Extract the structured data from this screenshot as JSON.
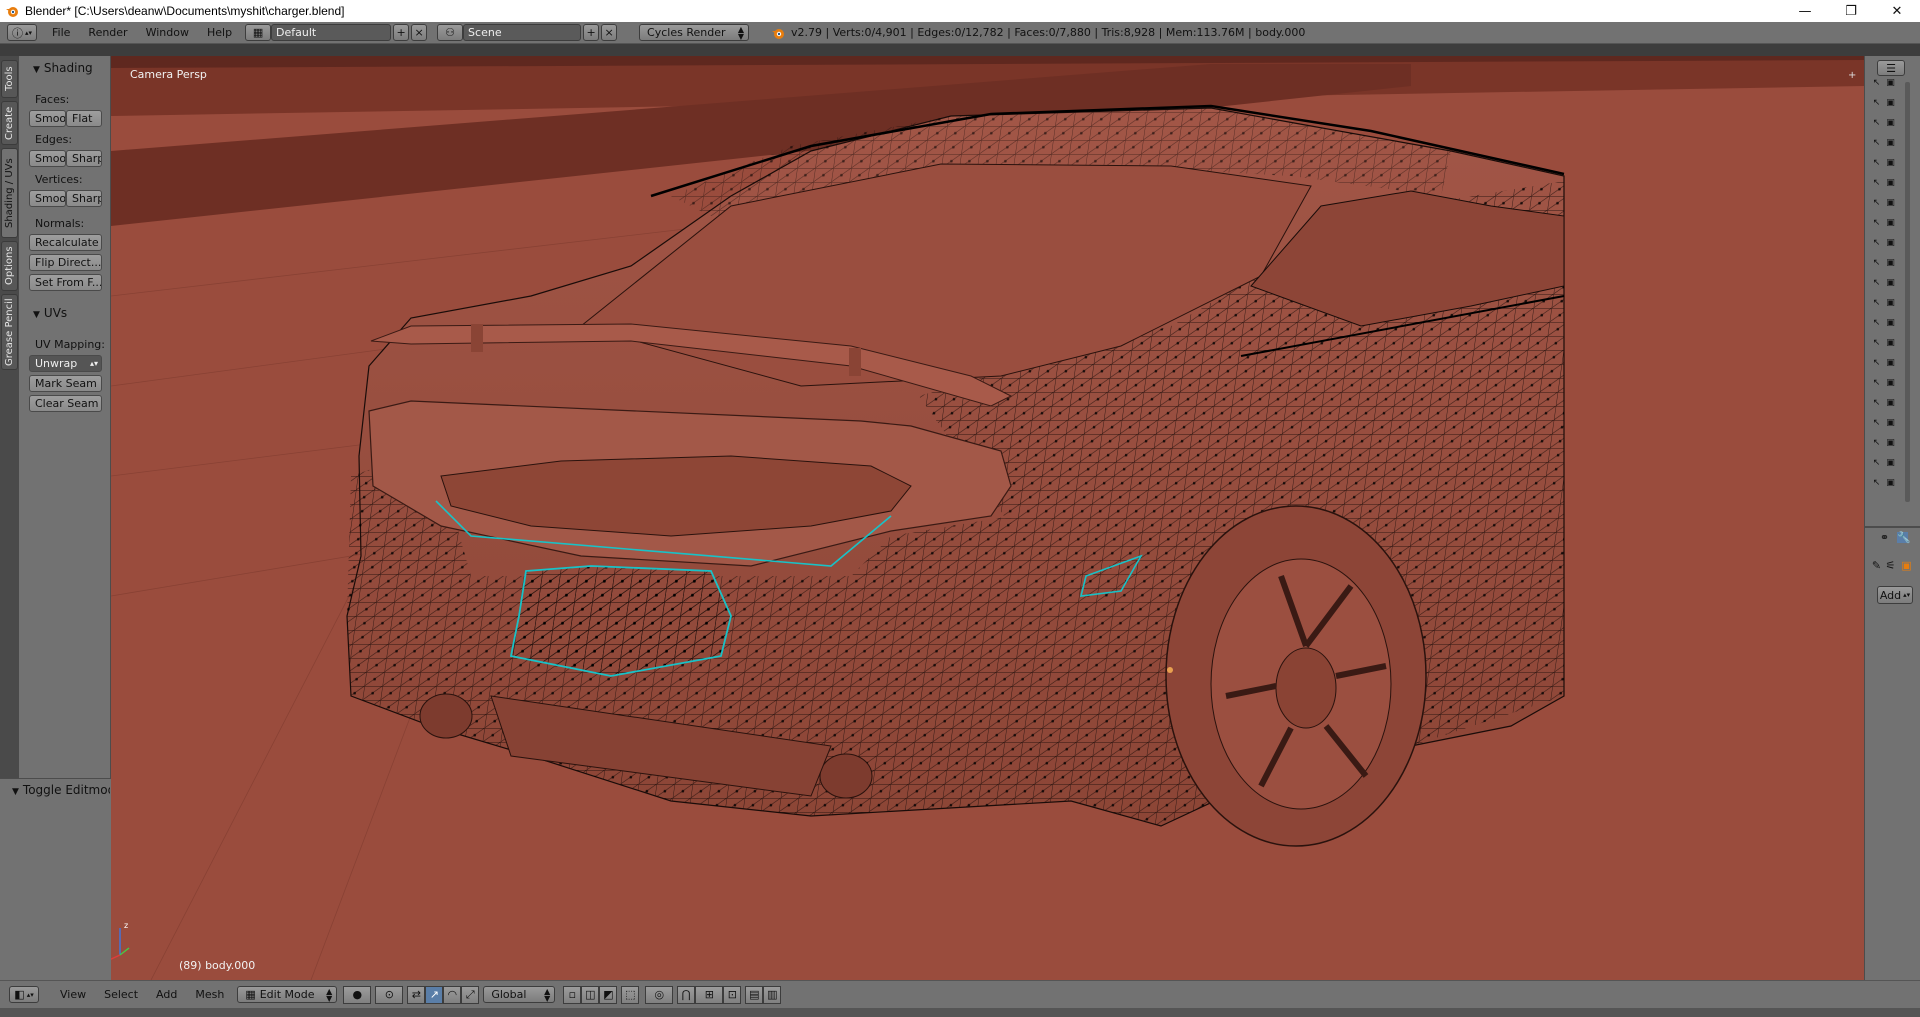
{
  "window": {
    "title": "Blender* [C:\\Users\\deanw\\Documents\\myshit\\charger.blend]",
    "controls": {
      "minimize": "—",
      "maximize": "❐",
      "close": "✕"
    }
  },
  "infobar": {
    "menus": [
      "File",
      "Render",
      "Window",
      "Help"
    ],
    "layout": "Default",
    "scene": "Scene",
    "render_engine": "Cycles Render",
    "stats": "v2.79 | Verts:0/4,901 | Edges:0/12,782 | Faces:0/7,880 | Tris:8,928 | Mem:113.76M | body.000"
  },
  "tool_tabs": [
    "Tools",
    "Create",
    "Shading / UVs",
    "Options",
    "Grease Pencil"
  ],
  "shading_panel": {
    "title": "Shading",
    "faces_label": "Faces:",
    "edges_label": "Edges:",
    "vertices_label": "Vertices:",
    "normals_label": "Normals:",
    "smooth": "Smoo",
    "flat": "Flat",
    "sharp": "Sharp",
    "recalculate": "Recalculate",
    "flip_direction": "Flip Direct...",
    "set_from_faces": "Set From F..."
  },
  "uvs_panel": {
    "title": "UVs",
    "uv_mapping_label": "UV Mapping:",
    "unwrap": "Unwrap",
    "mark_seam": "Mark Seam",
    "clear_seam": "Clear Seam"
  },
  "operator_panel": {
    "title": "Toggle Editmode"
  },
  "viewport": {
    "view_name": "Camera Persp",
    "object_info": "(89) body.000",
    "colors": {
      "background": "#9a4c3d",
      "dark_band": "#6e2f24",
      "mesh_body": "#9d5142",
      "wire": "#111111",
      "selection": "#19c2c7"
    }
  },
  "right_toolbar": {
    "add_button": "Add"
  },
  "bottom_header": {
    "menus": [
      "View",
      "Select",
      "Add",
      "Mesh"
    ],
    "mode": "Edit Mode",
    "orientation": "Global"
  }
}
